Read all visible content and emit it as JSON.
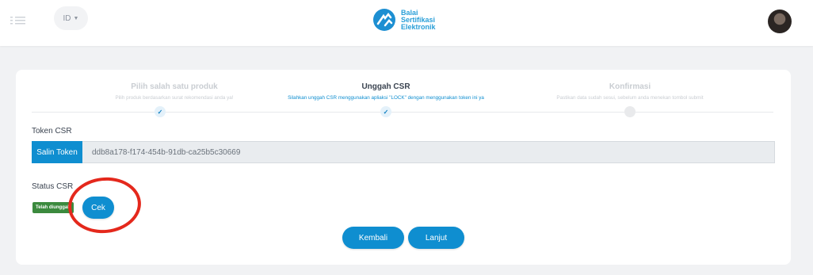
{
  "header": {
    "language": "ID",
    "logo_lines": [
      "Balai",
      "Sertifikasi",
      "Elektronik"
    ]
  },
  "steps": [
    {
      "title": "Pilih salah satu produk",
      "desc": "Pilih produk berdasarkan surat rekomendasi anda ya!",
      "status": "done"
    },
    {
      "title": "Unggah CSR",
      "desc": "Silahkan unggah CSR menggunakan apliaksi \"LOCK\" dengan menggunakan token ini ya",
      "status": "done"
    },
    {
      "title": "Konfirmasi",
      "desc": "Pastikan data sudah sesui, sebelum anda menekan tombol submit",
      "status": "pending"
    }
  ],
  "token": {
    "label": "Token CSR",
    "copy_label": "Salin Token",
    "value": "ddb8a178-f174-454b-91db-ca25b5c30669"
  },
  "status": {
    "label": "Status CSR",
    "badge": "Telah diunggah",
    "check_label": "Cek"
  },
  "actions": {
    "back_label": "Kembali",
    "next_label": "Lanjut"
  },
  "colors": {
    "primary": "#0f8ed0",
    "success_badge": "#3b8a3e",
    "annotation": "#e4281c",
    "background": "#f1f2f4"
  },
  "icons": {
    "menu": "menu-icon",
    "check": "check-icon",
    "logo": "bsre-logo"
  }
}
